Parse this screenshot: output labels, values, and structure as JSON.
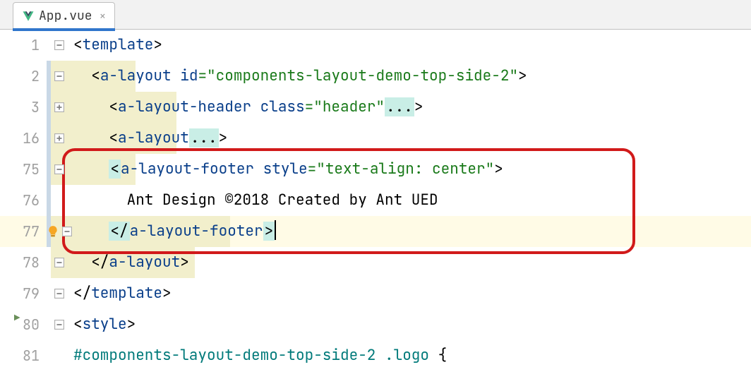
{
  "tab": {
    "filename": "App.vue"
  },
  "gutter": [
    "1",
    "2",
    "3",
    "16",
    "75",
    "76",
    "77",
    "78",
    "79",
    "80",
    "81"
  ],
  "code": {
    "l1": {
      "open": "<",
      "tag": "template",
      "close": ">"
    },
    "l2": {
      "open": "<",
      "tag": "a-layout",
      "sp": " ",
      "attr": "id",
      "eq": "=",
      "val": "\"components-layout-demo-top-side-2\"",
      "close": ">"
    },
    "l3": {
      "open": "<",
      "tag": "a-layout-header",
      "sp": " ",
      "attr": "class",
      "eq": "=",
      "val": "\"header\"",
      "fold": "...",
      "close": ">"
    },
    "l4": {
      "open": "<",
      "tag": "a-layout",
      "fold": "...",
      "close": ">"
    },
    "l5": {
      "open": "<",
      "tag": "a-layout-footer",
      "sp": " ",
      "attr": "style",
      "eq": "=",
      "val": "\"text-align: center\"",
      "close": ">"
    },
    "l6": {
      "text": "Ant Design ©2018 Created by Ant UED"
    },
    "l7": {
      "open": "</",
      "tag": "a-layout-footer",
      "close": ">"
    },
    "l8": {
      "open": "</",
      "tag": "a-layout",
      "close": ">"
    },
    "l9": {
      "open": "</",
      "tag": "template",
      "close": ">"
    },
    "l10": {
      "open": "<",
      "tag": "style",
      "close": ">"
    },
    "l11": {
      "sel": "#components-layout-demo-top-side-2 .logo ",
      "brace": "{"
    }
  }
}
